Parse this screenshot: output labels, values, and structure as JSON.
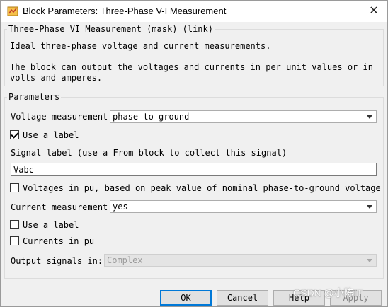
{
  "window": {
    "title": "Block Parameters: Three-Phase V-I Measurement",
    "app_icon": "simulink-block-icon",
    "close_glyph": "✕"
  },
  "mask": {
    "legend": "Three-Phase VI Measurement (mask) (link)",
    "description_line1": "Ideal three-phase voltage and current measurements.",
    "description_line2": "The block can output the voltages and currents in per unit values or in",
    "description_line3": "volts and amperes."
  },
  "parameters": {
    "legend": "Parameters",
    "voltage_measurement": {
      "label": "Voltage measurement",
      "value": "phase-to-ground"
    },
    "use_label_voltage": {
      "label": "Use a label",
      "checked": true
    },
    "signal_label": {
      "label": "Signal label  (use a From block to collect this signal)",
      "value": "Vabc"
    },
    "voltages_in_pu": {
      "label": "Voltages in pu,  based on peak value of nominal phase-to-ground voltage",
      "checked": false
    },
    "current_measurement": {
      "label": "Current measurement",
      "value": "yes"
    },
    "use_label_current": {
      "label": "Use a label",
      "checked": false
    },
    "currents_in_pu": {
      "label": "Currents in pu",
      "checked": false
    },
    "output_signals": {
      "label": "Output signals in:",
      "value": "Complex",
      "disabled": true
    }
  },
  "buttons": {
    "ok": "OK",
    "cancel": "Cancel",
    "help": "Help",
    "apply": "Apply"
  },
  "watermark": "CSDN @小陈IT",
  "colors": {
    "dialog_bg": "#f0f0f0",
    "default_button_border": "#0078d7",
    "disabled_bg": "#e4e4e4"
  }
}
